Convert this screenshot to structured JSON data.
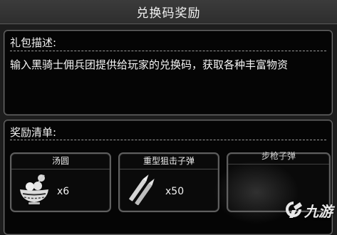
{
  "dialog": {
    "title": "兑换码奖励"
  },
  "description": {
    "label": "礼包描述:",
    "text": "输入黑骑士佣兵团提供给玩家的兑换码，获取各种丰富物资"
  },
  "rewards": {
    "label": "奖励清单:",
    "items": [
      {
        "name": "汤圆",
        "quantity": "x6",
        "icon": "tangyuan-bowl-icon"
      },
      {
        "name": "重型狙击子弹",
        "quantity": "x50",
        "icon": "sniper-bullets-icon"
      },
      {
        "name": "步枪子弹",
        "quantity": "",
        "icon": "rifle-bullets-icon"
      }
    ]
  },
  "watermark": {
    "text": "九游",
    "icon": "9game-logo-icon"
  }
}
